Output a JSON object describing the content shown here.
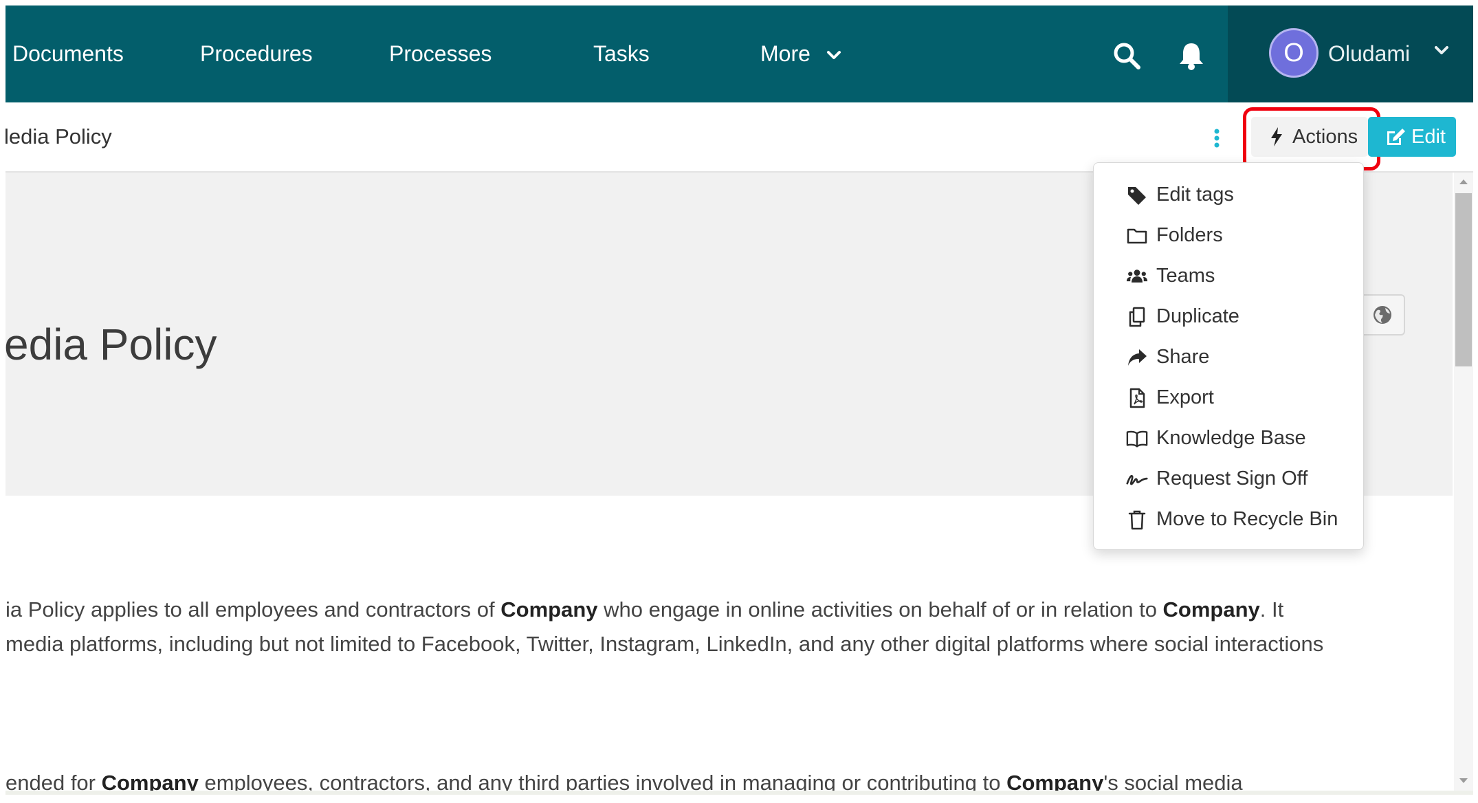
{
  "nav": {
    "items": [
      "Documents",
      "Procedures",
      "Processes",
      "Tasks"
    ],
    "more_label": "More",
    "bg_color": "#035e6b"
  },
  "user": {
    "initial": "O",
    "name": "Oludami"
  },
  "subheader": {
    "title": "ledia Policy"
  },
  "toolbar": {
    "actions_label": "Actions",
    "edit_label": "Edit",
    "edit_color": "#1eb7d1",
    "highlight_color": "#f0000f"
  },
  "hero": {
    "title": "edia Policy"
  },
  "actions_menu": [
    {
      "label": "Edit tags",
      "icon": "tag-icon"
    },
    {
      "label": "Folders",
      "icon": "folder-icon"
    },
    {
      "label": "Teams",
      "icon": "users-icon"
    },
    {
      "label": "Duplicate",
      "icon": "copy-icon"
    },
    {
      "label": "Share",
      "icon": "share-icon"
    },
    {
      "label": "Export",
      "icon": "pdf-file-icon"
    },
    {
      "label": "Knowledge Base",
      "icon": "book-icon"
    },
    {
      "label": "Request Sign Off",
      "icon": "signature-icon"
    },
    {
      "label": "Move to Recycle Bin",
      "icon": "trash-icon"
    }
  ],
  "body": {
    "p1": {
      "line1_a": "ia Policy applies to all employees and contractors of ",
      "line1_b": "Company",
      "line1_c": " who engage in online activities on behalf of or in relation to ",
      "line1_d": "Company",
      "line1_e": ". It",
      "line2": " media platforms, including but not limited to Facebook, Twitter, Instagram, LinkedIn, and any other digital platforms where social interactions"
    },
    "p2": {
      "a": "ended for ",
      "b": "Company",
      "c": " employees, contractors, and any third parties involved in managing or contributing to ",
      "d": "Company",
      "e": "'s social media"
    }
  }
}
